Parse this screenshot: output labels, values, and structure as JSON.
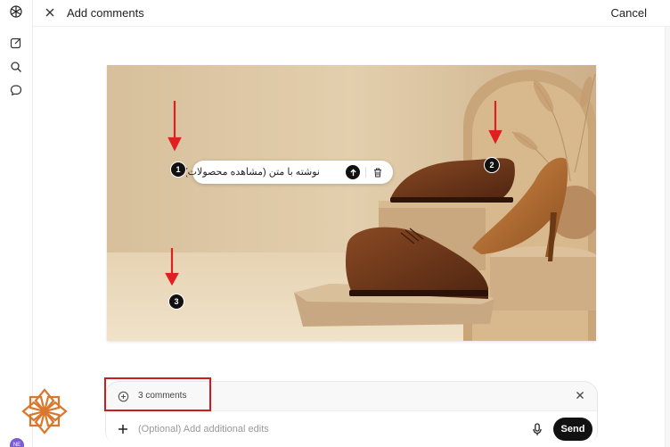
{
  "header": {
    "title": "Add comments",
    "cancel_label": "Cancel"
  },
  "rail": {
    "avatar_initials": "NE"
  },
  "image": {
    "markers": [
      "1",
      "2",
      "3"
    ],
    "comment_text": "نوشته با متن (مشاهده محصولات)بنویس"
  },
  "composer": {
    "comments_count_label": "3 comments",
    "input_value": "",
    "input_placeholder": "(Optional) Add additional edits",
    "send_label": "Send"
  },
  "colors": {
    "accent": "#111111",
    "annotation_red": "#d11a1a",
    "logo_orange": "#d9782d"
  }
}
